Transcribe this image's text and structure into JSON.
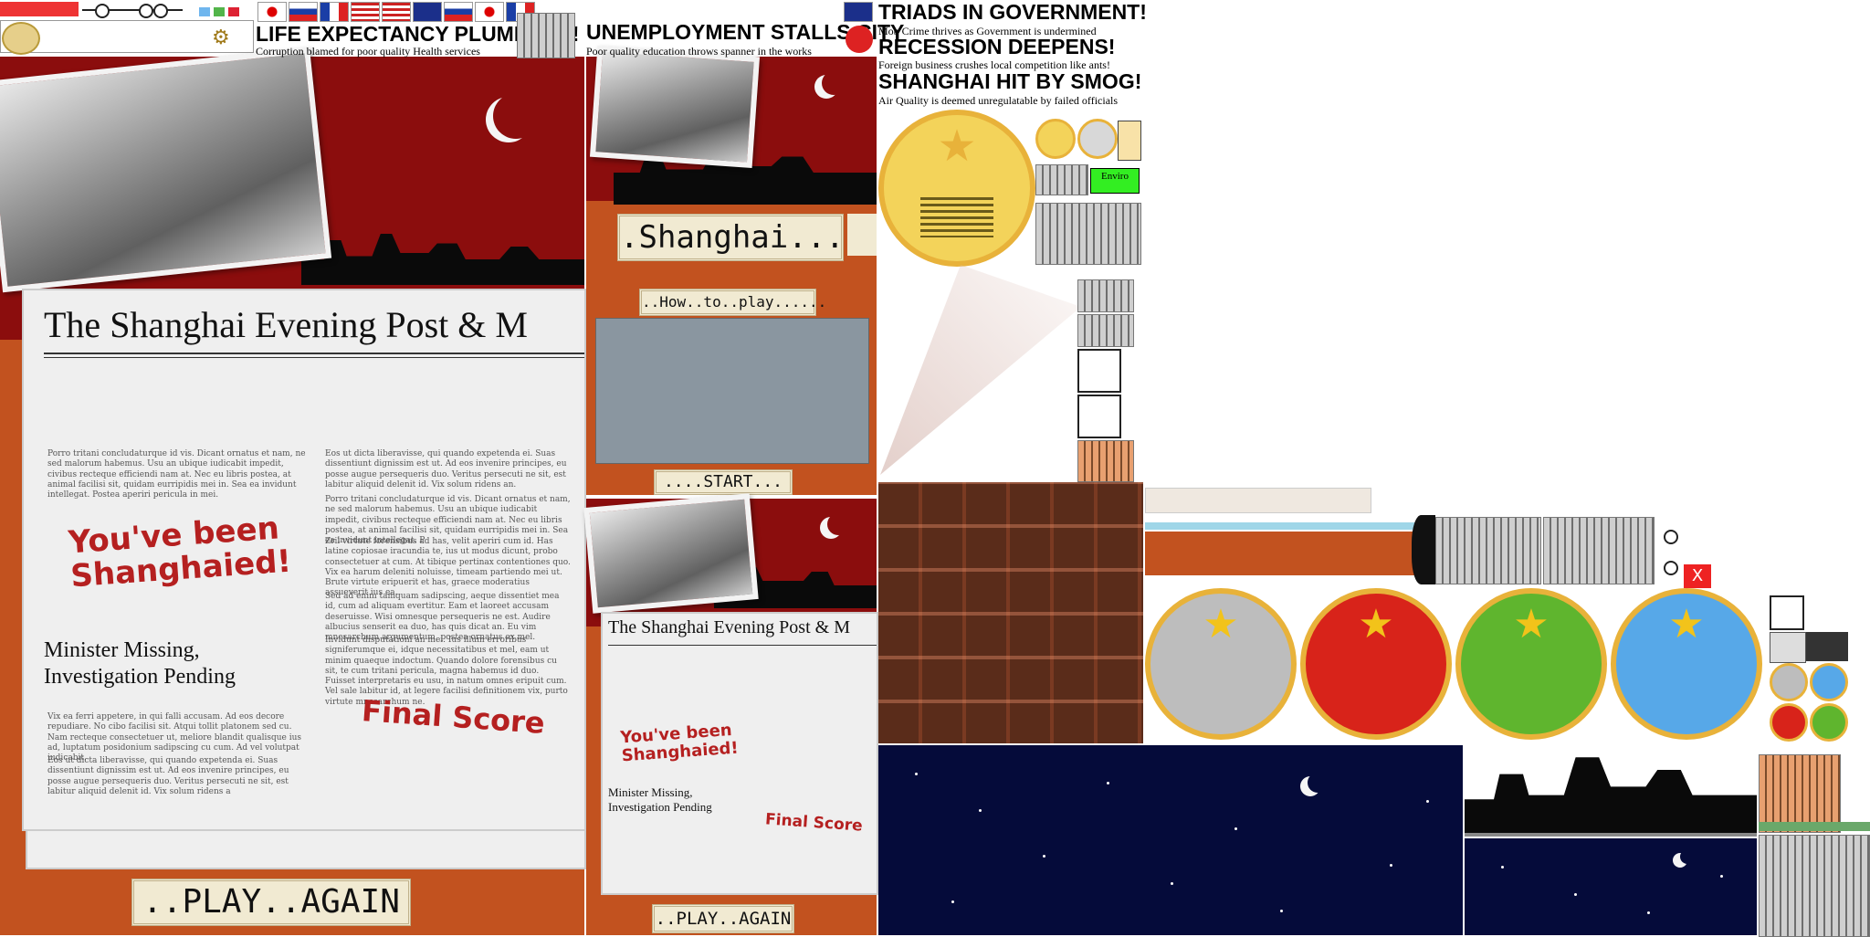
{
  "newspaper": {
    "masthead": "The Shanghai Evening Post & M",
    "stamp_line1": "You've been",
    "stamp_line2": "Shanghaied!",
    "headline_line1": "Minister Missing,",
    "headline_line2": "Investigation Pending",
    "final_score": "Final Score",
    "lorem_1": "Porro tritani concludaturque id vis. Dicant ornatus et nam, ne sed malorum habemus. Usu an ubique iudicabit impedit, civibus recteque efficiendi nam at. Nec eu libris postea, at animal facilisi sit, quidam eurripidis mei in. Sea ea invidunt intellegat. Postea aperiri pericula in mei.",
    "lorem_2": "Eos ut dicta liberavisse, qui quando expetenda ei. Suas dissentiunt dignissim est ut. Ad eos invenire principes, eu posse augue persequeris duo. Veritus persecuti ne sit, est labitur aliquid delenit id. Vix solum ridens an.",
    "lorem_3": "Porro tritani concludaturque id vis. Dicant ornatus et nam, ne sed malorum habemus. Usu an ubique iudicabit impedit, civibus recteque efficiendi nam at. Nec eu libris postea, at animal facilisi sit, quidam eurripidis mei in. Sea ea invidunt intellegat. P",
    "lorem_4": "Zril virtute forensibus ad has, velit aperiri cum id. Has latine copiosae iracundia te, ius ut modus dicunt, probo consectetuer at cum. At tibique pertinax contentiones quo. Vix ea harum deleniti noluisse, timeam partiendo mei ut. Brute virtute eripuerit et has, graece moderatius assueverit ius ea.",
    "lorem_5": "Sed ad enim tamquam sadipscing, aeque dissentiet mea id, cum ad aliquam evertitur. Eam et laoreet accusam deseruisse. Wisi omnesque persequeris ne est. Audire albucius senserit ea duo, has quis dicat an. Eu vim mnesarchum argumentum, postea ornatus ex mel.",
    "lorem_6": "Invidunt disputationi an mei. Ius illum erroribus signiferumque ei, idque necessitatibus et mel, eam ut minim quaeque indoctum. Quando dolore forensibus cu sit, te cum tritani pericula, magna habemus id duo. Fuisset interpretaris eu usu, in natum omnes eripuit cum. Vel sale labitur id, at legere facilisi definitionem vix, purto virtute mnesarchum ne.",
    "lorem_7": "Vix ea ferri appetere, in qui falli accusam. Ad eos decore repudiare. No cibo facilisi sit. Atqui tollit platonem sed cu. Nam recteque consectetuer ut, meliore blandit qualisque ius ad, luptatum posidonium sadipscing cu cum. Ad vel volutpat iudicabit.",
    "lorem_8": "Eos ut dicta liberavisse, qui quando expetenda ei. Suas dissentiunt dignissim est ut. Ad eos invenire principes, eu posse augue persequeris duo. Veritus persecuti ne sit, est labitur aliquid delenit id. Vix solum ridens a"
  },
  "buttons": {
    "play_again": "..PLAY..AGAIN",
    "play_again_small": "..PLAY..AGAIN",
    "start": "....START...",
    "how_to_play": "..How..to..play......",
    "shanghai": ".Shanghai...",
    "enviro": "Enviro",
    "close": "X"
  },
  "headlines": {
    "h1_title": "LIFE EXPECTANCY PLUMMETS!",
    "h1_sub": "Corruption blamed for poor quality Health services",
    "h2_title": "UNEMPLOYMENT STALLS CITY",
    "h2_sub": "Poor quality education throws spanner in the works",
    "h3_title": "TRIADS IN GOVERNMENT!",
    "h3_sub": "Mob Crime thrives as Government is undermined",
    "h4_title": "RECESSION DEEPENS!",
    "h4_sub": "Foreign business crushes local competition like ants!",
    "h5_title": "SHANGHAI HIT BY SMOG!",
    "h5_sub": "Air Quality is deemed unregulatable by failed officials"
  },
  "icons": {
    "flags": [
      "japan-flag-icon",
      "russia-flag-icon",
      "france-flag-icon",
      "usa-flag-icon",
      "uk-flag-icon",
      "russia-flag-icon",
      "japan-flag-icon",
      "france-flag-icon"
    ],
    "medal_colors": [
      "#bdbdbd",
      "#d8231a",
      "#5fb52e",
      "#57a8e8"
    ]
  },
  "colors": {
    "red": "#8b0d0d",
    "orange": "#c2521f",
    "paper": "#efefef",
    "stamp": "#b52020",
    "gold": "#e8b23a",
    "night": "#050b3a",
    "enviro_green": "#33ee22"
  }
}
